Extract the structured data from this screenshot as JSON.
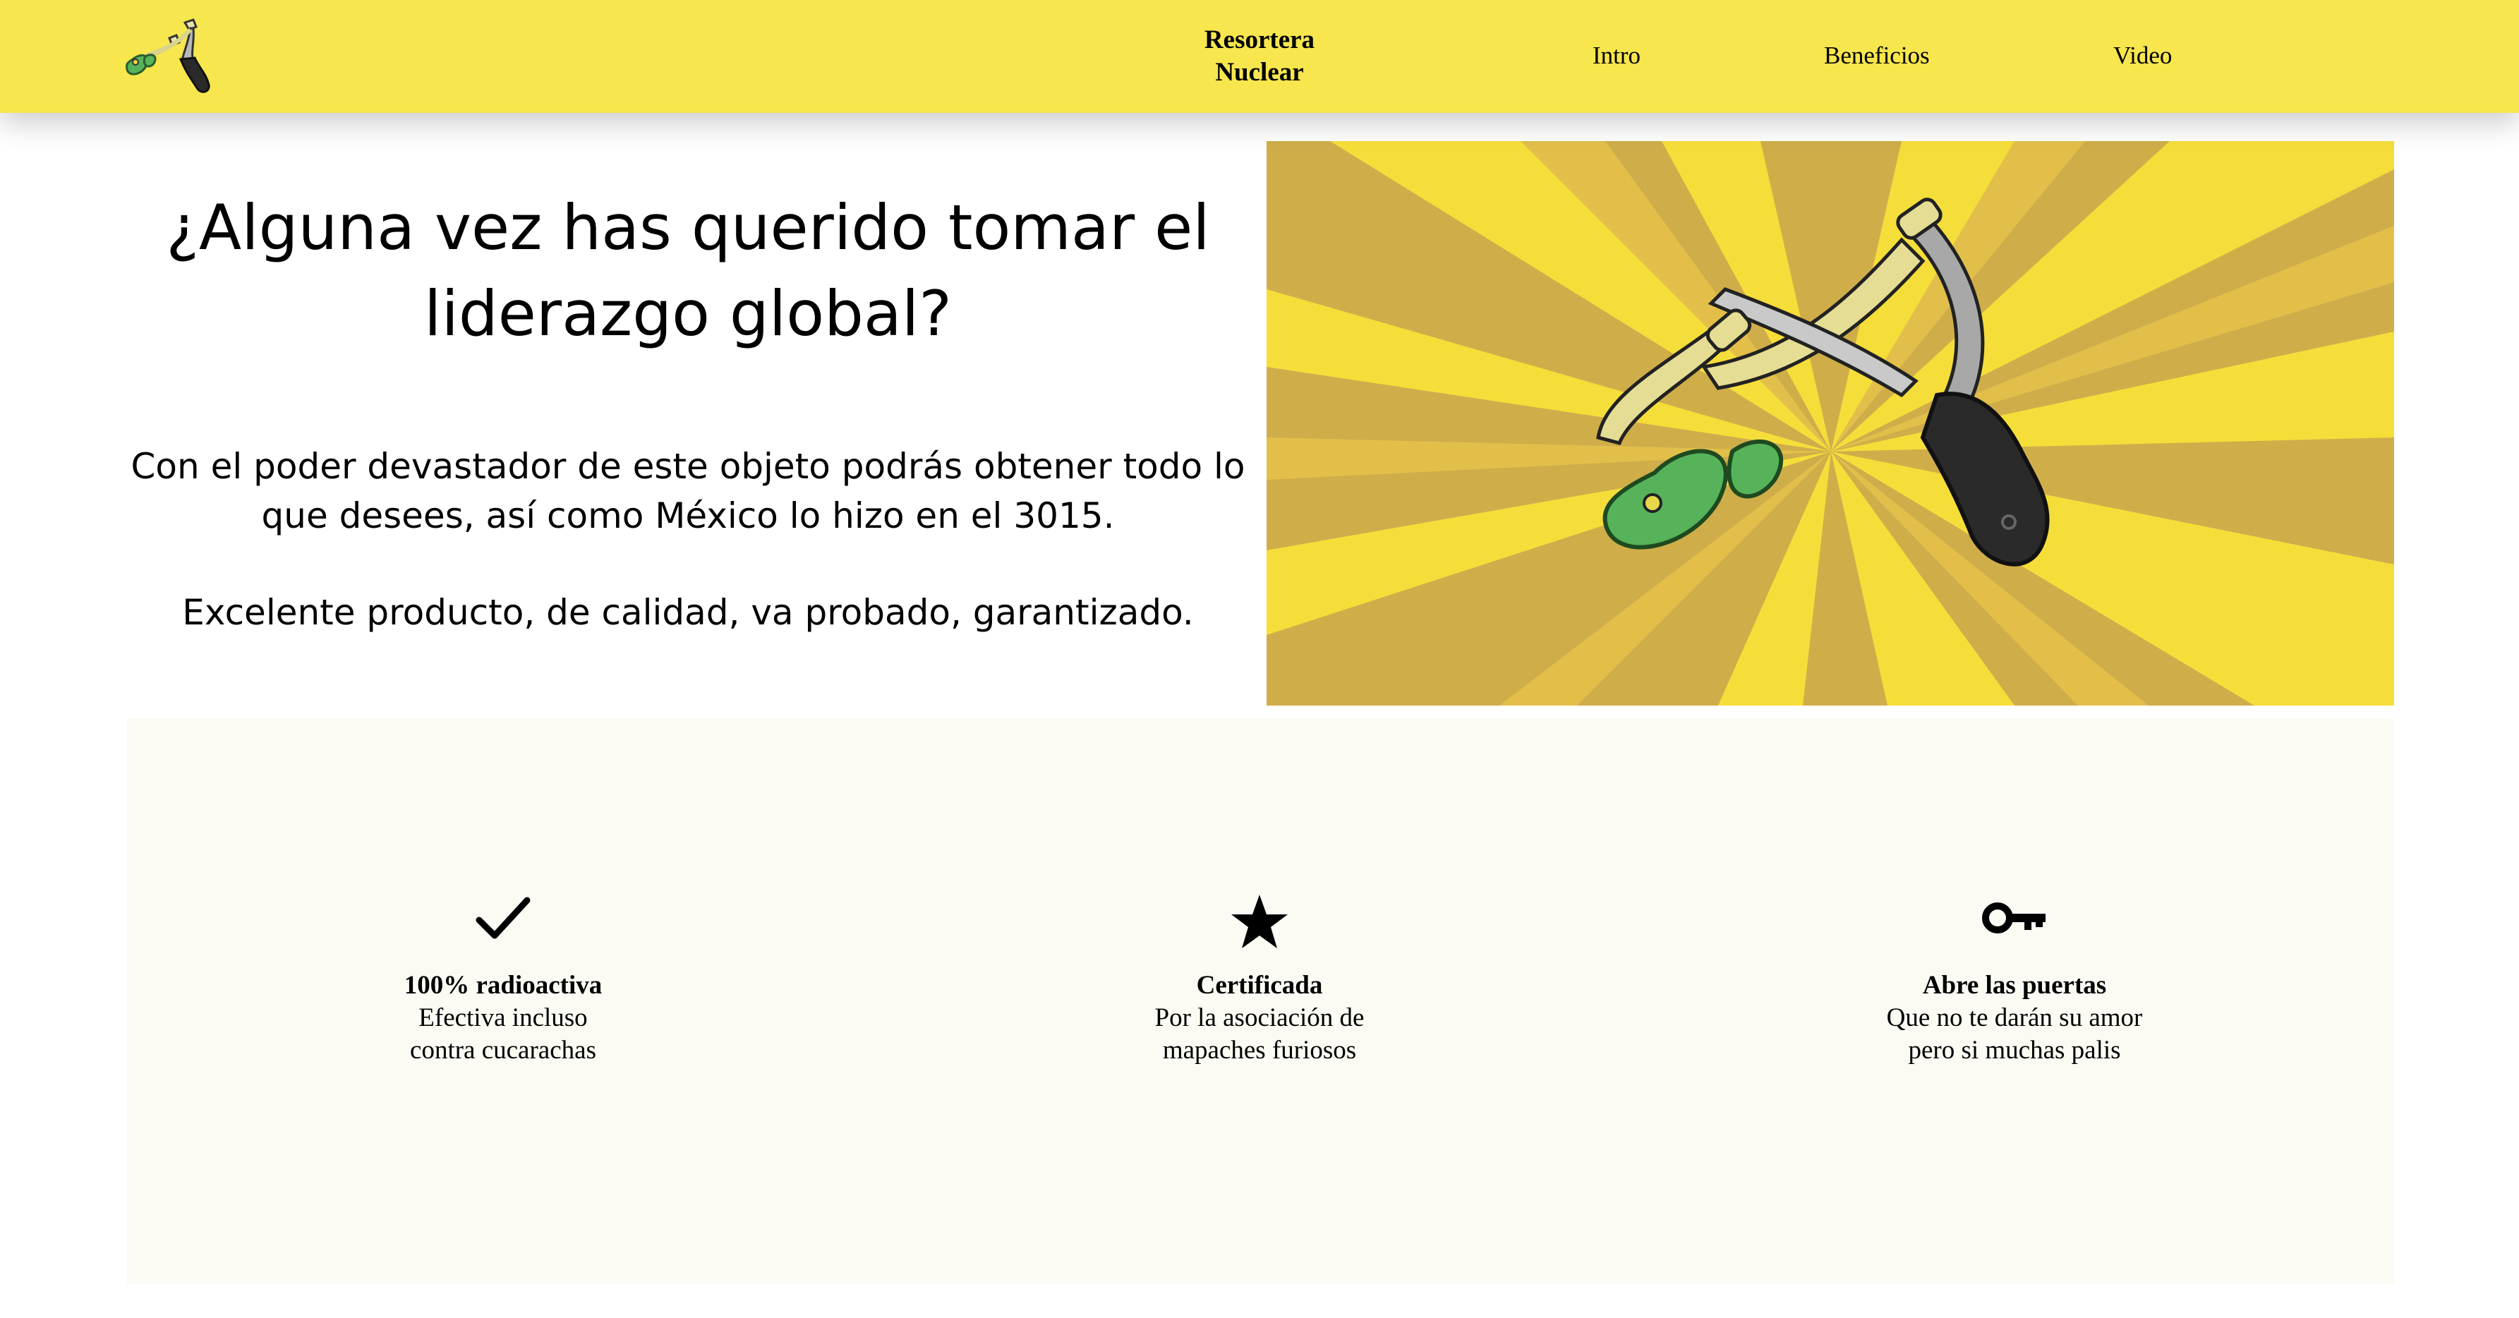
{
  "header": {
    "logo_icon": "slingshot-icon",
    "brand": "Resortera Nuclear",
    "nav": [
      {
        "label": "Intro"
      },
      {
        "label": "Beneficios"
      },
      {
        "label": "Video"
      }
    ],
    "background": "#f7e64d"
  },
  "hero": {
    "title": "¿Alguna vez has querido tomar el liderazgo global?",
    "paragraph1": "Con el poder devastador de este objeto podrás obtener todo lo que desees, así como México lo hizo en el 3015.",
    "paragraph2": "Excelente producto, de calidad, va probado, garantizado.",
    "image_icon": "slingshot-illustration",
    "colors": {
      "ray_light": "#f6de3a",
      "ray_dark": "#cfae4a",
      "band_green": "#56b35a",
      "handle_black": "#2a2a2a"
    }
  },
  "features": {
    "background": "#fbfbf4",
    "items": [
      {
        "icon": "check-icon",
        "title": "100% radioactiva",
        "line1": "Efectiva incluso",
        "line2": "contra cucarachas"
      },
      {
        "icon": "star-icon",
        "title": "Certificada",
        "line1": "Por la asociación de",
        "line2": "mapaches furiosos"
      },
      {
        "icon": "key-icon",
        "title": "Abre las puertas",
        "line1": "Que no te darán su amor",
        "line2": "pero si muchas palis"
      }
    ]
  }
}
